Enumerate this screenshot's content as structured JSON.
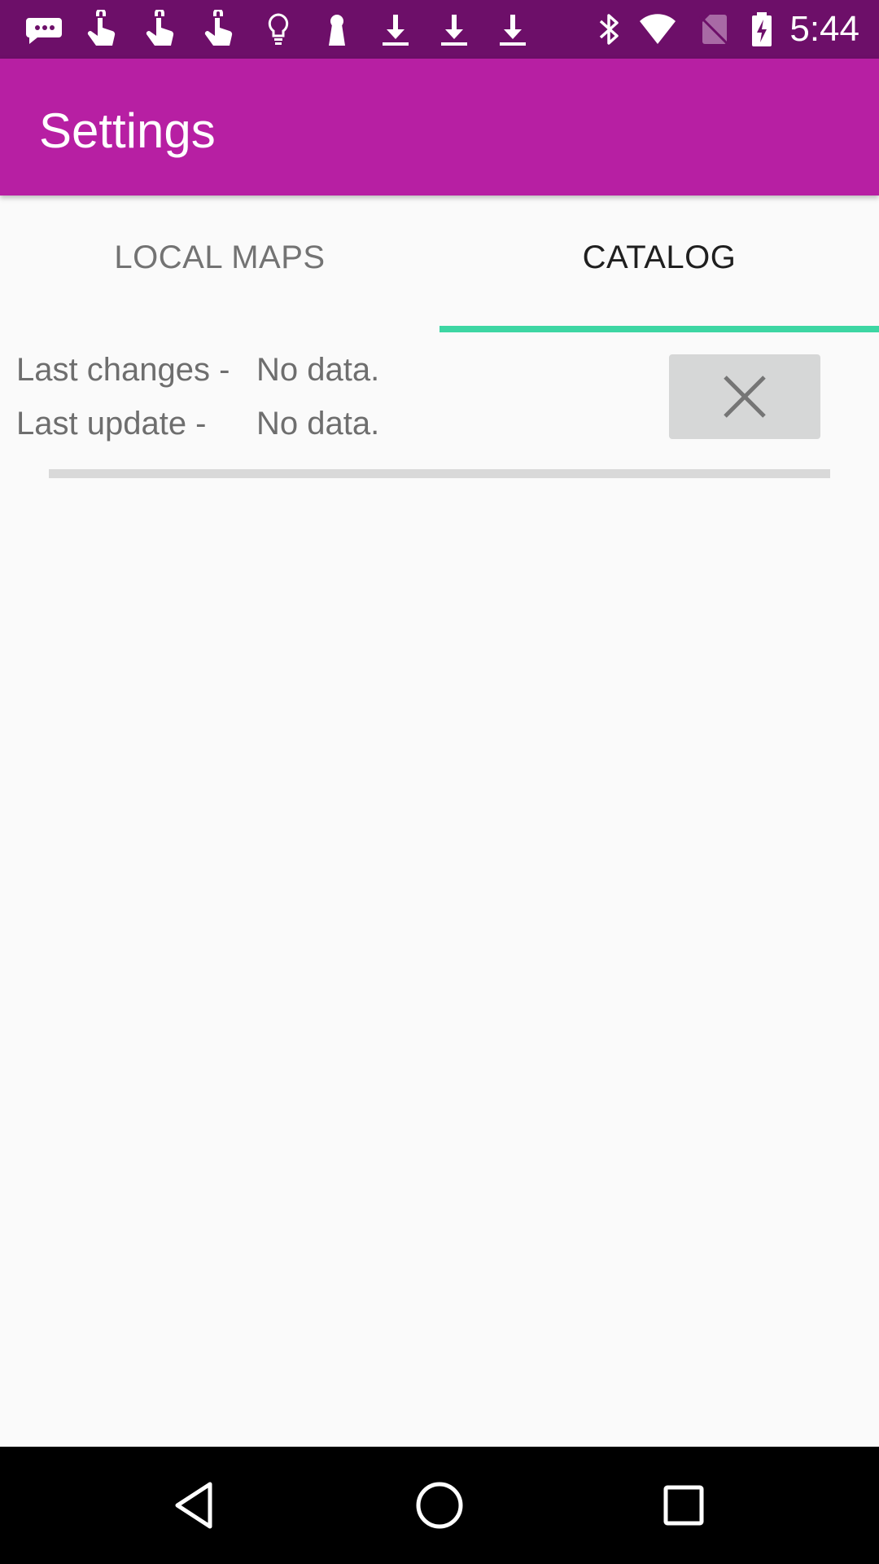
{
  "status_bar": {
    "time": "5:44",
    "background": "#6d0f69",
    "icons_left": [
      "message-icon",
      "touch-icon",
      "touch-icon",
      "touch-icon",
      "lightbulb-icon",
      "keyhole-icon",
      "download-icon",
      "download-icon",
      "download-icon"
    ],
    "icons_right": [
      "bluetooth-icon",
      "wifi-icon",
      "no-sim-icon",
      "battery-charging-icon"
    ]
  },
  "app_bar": {
    "title": "Settings",
    "background": "#b71fa3"
  },
  "tabs": [
    {
      "label": "LOCAL MAPS",
      "selected": false
    },
    {
      "label": "CATALOG",
      "selected": true
    }
  ],
  "tab_indicator_color": "#3dd6a3",
  "catalog": {
    "last_changes_label": "Last changes -",
    "last_changes_value": "No data.",
    "last_update_label": "Last update -",
    "last_update_value": "No data.",
    "cancel_icon": "close-icon"
  },
  "nav_bar": {
    "buttons": [
      "back-icon",
      "home-icon",
      "recents-icon"
    ]
  }
}
